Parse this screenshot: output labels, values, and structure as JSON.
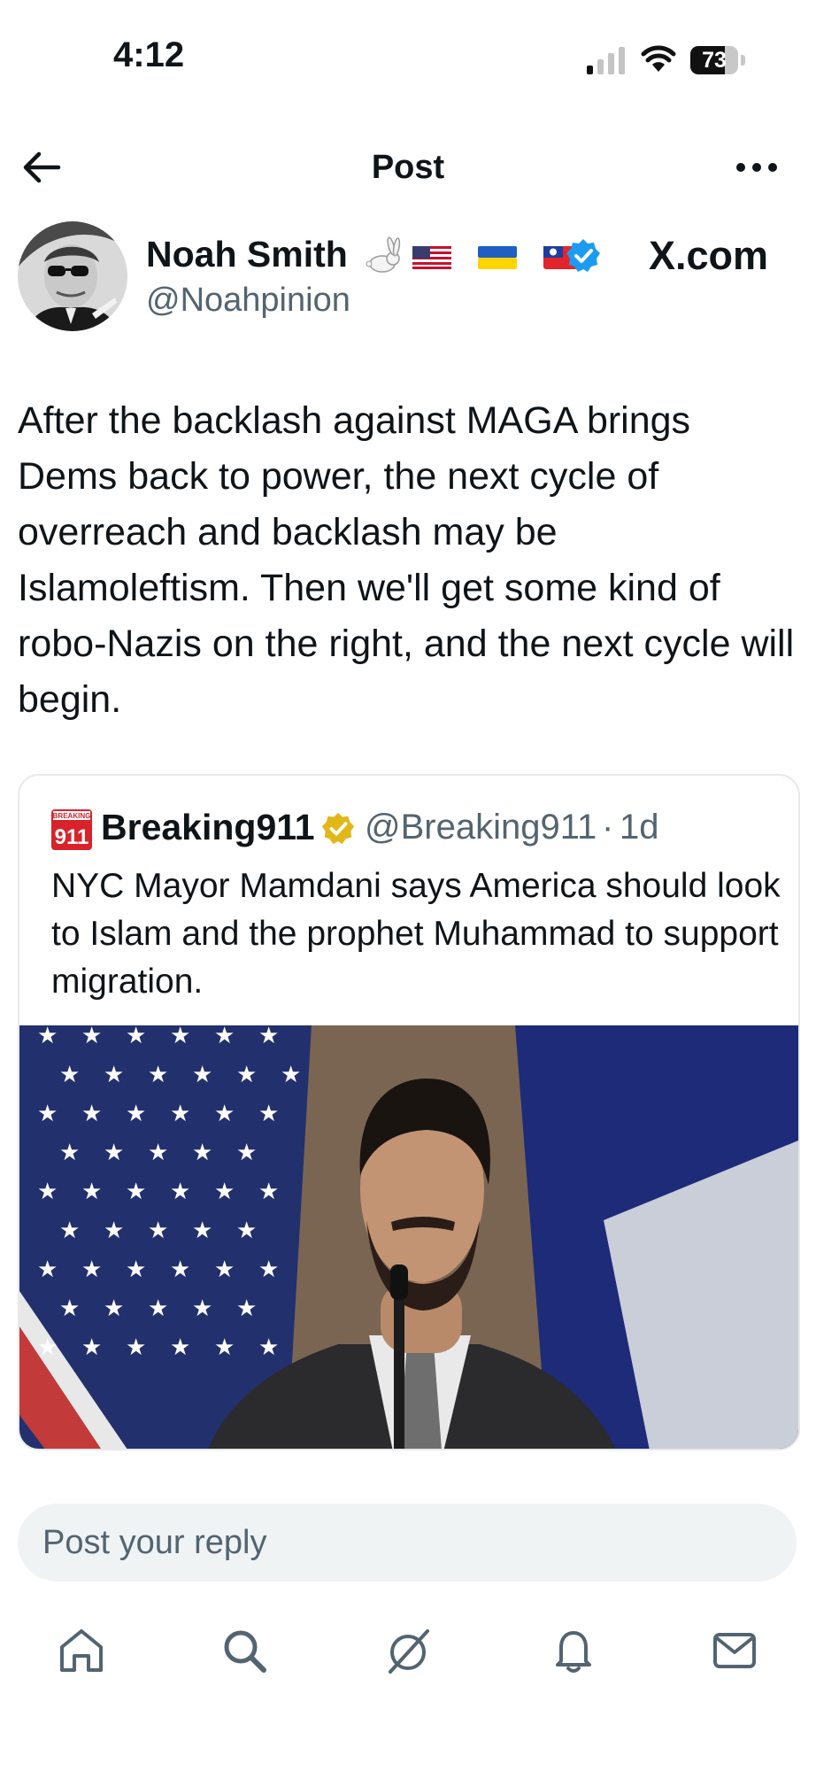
{
  "status_bar": {
    "time": "4:12",
    "battery": "73",
    "battery_level": 0.73
  },
  "header": {
    "title": "Post"
  },
  "post": {
    "author_name": "Noah Smith",
    "author_handle": "@Noahpinion",
    "watermark": "X.com",
    "text": "After the backlash against MAGA brings Dems back to power, the next cycle of overreach and backlash may be Islamoleftism. Then we'll get some kind of robo-Nazis on the right, and the next cycle will begin."
  },
  "quoted_post": {
    "logo_text": "911",
    "name": "Breaking911",
    "handle": "@Breaking911",
    "separator": "·",
    "time": "1d",
    "text": "NYC Mayor Mamdani says America should look to Islam and the prophet Muhammad to support migration."
  },
  "reply": {
    "placeholder": "Post your reply"
  },
  "bottom_nav": [
    "home-icon",
    "search-icon",
    "grok-icon",
    "notifications-icon",
    "messages-icon"
  ],
  "colors": {
    "verified_blue": "#1d9bf0",
    "gold_badge": "#e2b719",
    "breaking_red": "#d8232a",
    "secondary_text": "#536471"
  }
}
